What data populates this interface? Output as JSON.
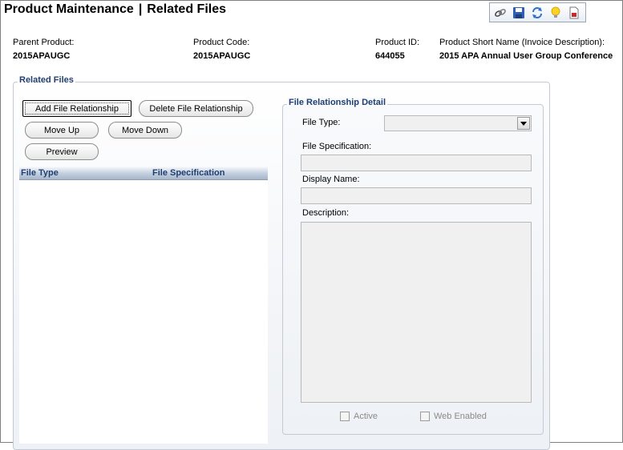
{
  "header": {
    "title_main": "Product Maintenance",
    "title_separator": "|",
    "title_sub": "Related Files"
  },
  "toolbar": {
    "icons": [
      "link-icon",
      "save-icon",
      "refresh-icon",
      "lightbulb-icon",
      "report-icon"
    ]
  },
  "product_info": {
    "parent_product": {
      "label": "Parent Product:",
      "value": "2015APAUGC"
    },
    "product_code": {
      "label": "Product Code:",
      "value": "2015APAUGC"
    },
    "product_id": {
      "label": "Product ID:",
      "value": "644055"
    },
    "short_name": {
      "label": "Product Short Name (Invoice Description):",
      "value": "2015 APA Annual User Group Conference"
    }
  },
  "related_files": {
    "legend": "Related Files",
    "buttons": {
      "add": "Add File Relationship",
      "delete": "Delete File Relationship",
      "move_up": "Move Up",
      "move_down": "Move Down",
      "preview": "Preview"
    },
    "grid": {
      "columns": [
        "File Type",
        "File Specification"
      ],
      "rows": []
    }
  },
  "detail": {
    "legend": "File Relationship Detail",
    "file_type_label": "File Type:",
    "file_type_value": "",
    "file_spec_label": "File Specification:",
    "file_spec_value": "",
    "display_name_label": "Display Name:",
    "display_name_value": "",
    "description_label": "Description:",
    "description_value": "",
    "active_label": "Active",
    "web_enabled_label": "Web Enabled"
  },
  "colors": {
    "legend_text": "#1f3f73",
    "grid_header": "#c4d0df",
    "disabled_field": "#f0f0f0"
  }
}
